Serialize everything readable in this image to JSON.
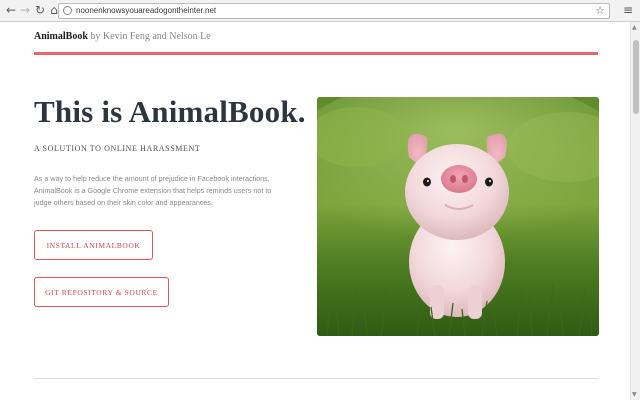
{
  "browser": {
    "url": "noonenknowsyouareadogontheinter.net",
    "back_glyph": "←",
    "forward_glyph": "→",
    "reload_glyph": "↻",
    "home_glyph": "⌂",
    "star_glyph": "☆",
    "menu_glyph": "≡"
  },
  "header": {
    "brand": "AnimalBook",
    "byline": " by Kevin Feng and Nelson Le"
  },
  "hero": {
    "title": "This is AnimalBook.",
    "subtitle": "A SOLUTION TO ONLINE HARASSMENT",
    "description": "As a way to help reduce the amount of prejudice in Facebook interactions, AnimalBook is a Google Chrome extension that helps reminds users not to judge others based on their skin color and appearances.",
    "image_icon": "piglet-photo"
  },
  "buttons": {
    "install_label": "INSTALL ANIMALBOOK",
    "git_label": "GIT REPOSITORY & SOURCE"
  },
  "colors": {
    "accent": "#e8636a",
    "title": "#2d3640",
    "button_text": "#d9474f"
  }
}
